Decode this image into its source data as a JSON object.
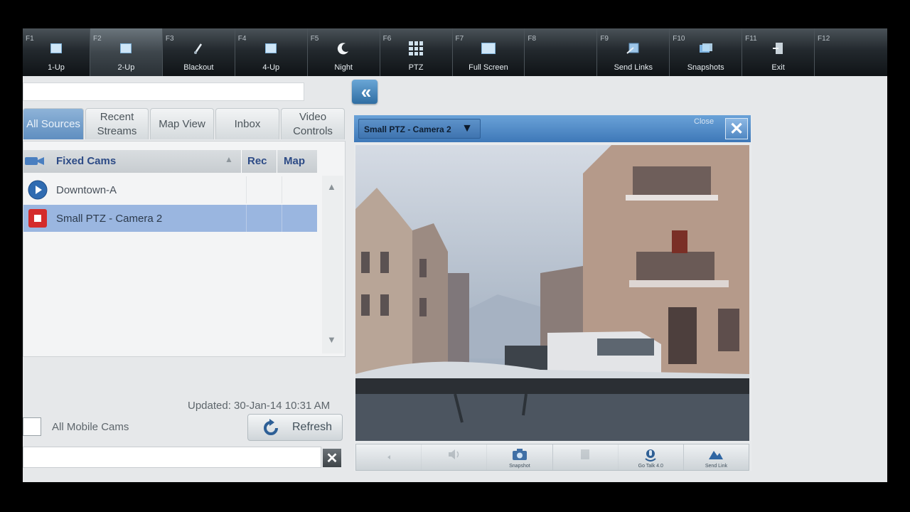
{
  "toolbar": {
    "keys": [
      {
        "key": "F1",
        "label": "1-Up",
        "icon": "single-view-icon"
      },
      {
        "key": "F2",
        "label": "2-Up",
        "icon": "two-up-icon",
        "active": true
      },
      {
        "key": "F3",
        "label": "Blackout",
        "icon": "blackout-icon"
      },
      {
        "key": "F4",
        "label": "4-Up",
        "icon": "four-up-icon"
      },
      {
        "key": "F5",
        "label": "Night",
        "icon": "moon-icon"
      },
      {
        "key": "F6",
        "label": "PTZ",
        "icon": "ptz-grid-icon"
      },
      {
        "key": "F7",
        "label": "Full Screen",
        "icon": "full-screen-icon"
      },
      {
        "key": "F8",
        "label": "",
        "icon": ""
      },
      {
        "key": "F9",
        "label": "Send Links",
        "icon": "send-links-icon"
      },
      {
        "key": "F10",
        "label": "Snapshots",
        "icon": "snapshots-icon"
      },
      {
        "key": "F11",
        "label": "Exit",
        "icon": "exit-icon"
      },
      {
        "key": "F12",
        "label": "",
        "icon": ""
      }
    ]
  },
  "tabs": [
    {
      "label": "All Sources",
      "active": true
    },
    {
      "label": "Recent Streams"
    },
    {
      "label": "Map View"
    },
    {
      "label": "Inbox"
    },
    {
      "label": "Video Controls"
    }
  ],
  "list": {
    "header": {
      "name": "Fixed Cams",
      "rec": "Rec",
      "map": "Map"
    },
    "rows": [
      {
        "name": "Downtown-A",
        "status": "playing"
      },
      {
        "name": "Small PTZ - Camera 2",
        "status": "recording",
        "selected": true
      }
    ]
  },
  "updated": "Updated: 30-Jan-14 10:31 AM",
  "mobile_checkbox_label": "All Mobile Cams",
  "refresh_label": "Refresh",
  "video": {
    "camera_select": "Small PTZ - Camera 2",
    "close_label": "Close",
    "toolbar": [
      {
        "label": "",
        "icon": "speaker-icon",
        "enabled": false
      },
      {
        "label": "",
        "icon": "volume-icon",
        "enabled": false
      },
      {
        "label": "Snapshot",
        "icon": "camera-icon",
        "enabled": true
      },
      {
        "label": "",
        "icon": "record-icon",
        "enabled": false
      },
      {
        "label": "Go Talk 4.0",
        "icon": "talk-icon",
        "enabled": true
      },
      {
        "label": "Send Link",
        "icon": "send-link-icon",
        "enabled": true
      }
    ]
  },
  "colors": {
    "accent": "#4a86c6",
    "selected_row": "#9ab6e0",
    "toolbar_bg": "#1b2126"
  }
}
